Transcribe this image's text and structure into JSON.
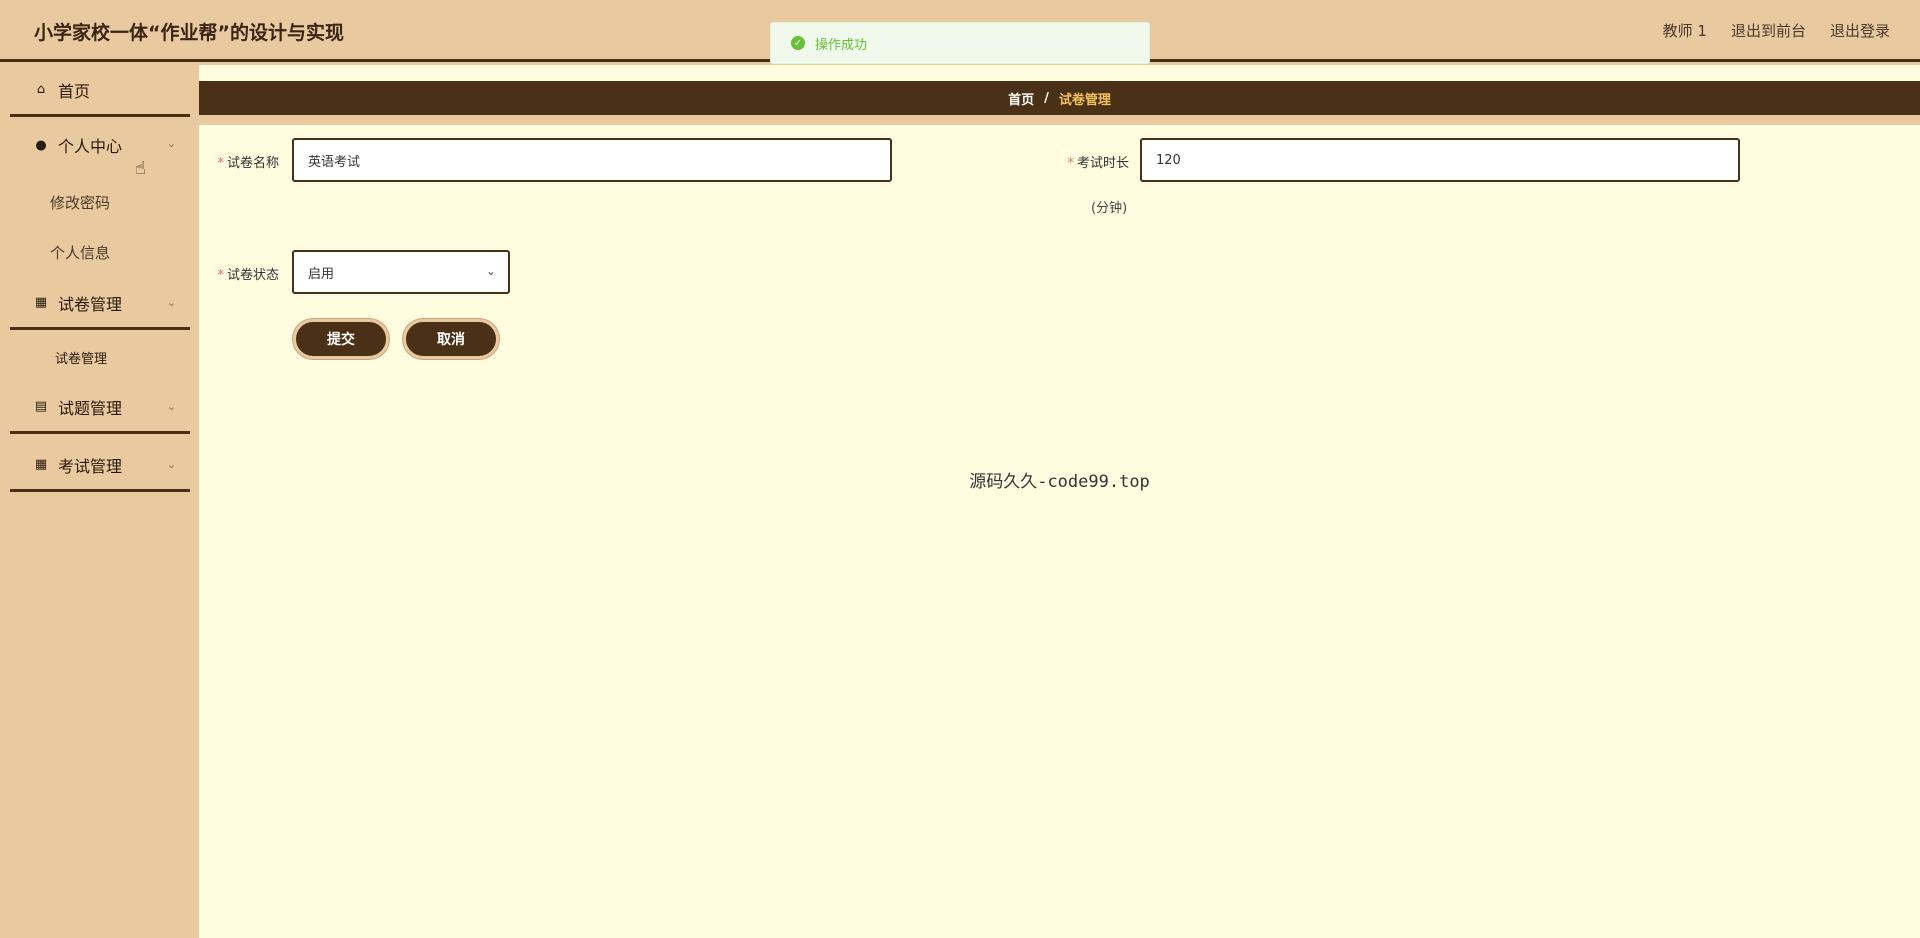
{
  "header": {
    "title": "小学家校一体“作业帮”的设计与实现",
    "user": "教师 1",
    "back_to_front": "退出到前台",
    "logout": "退出登录"
  },
  "toast": {
    "message": "操作成功"
  },
  "sidebar": {
    "home": "首页",
    "personal_center": "个人中心",
    "change_password": "修改密码",
    "personal_info": "个人信息",
    "paper_mgmt": "试卷管理",
    "paper_mgmt_sub": "试卷管理",
    "question_mgmt": "试题管理",
    "exam_mgmt": "考试管理"
  },
  "breadcrumb": {
    "home": "首页",
    "separator": "/",
    "current": "试卷管理"
  },
  "form": {
    "required_mark": "*",
    "paper_name_label": "试卷名称",
    "paper_name_value": "英语考试",
    "duration_label": "考试时长",
    "duration_value": "120",
    "duration_unit": "(分钟)",
    "status_label": "试卷状态",
    "status_value": "启用",
    "submit": "提交",
    "cancel": "取消"
  },
  "footer_note": "源码久久-code99.top",
  "colors": {
    "sidebar_bg": "#e8c9a0",
    "primary_dark": "#4a3016",
    "main_bg": "#fffce0",
    "breadcrumb_current": "#f3c25a",
    "success": "#67c23a"
  }
}
